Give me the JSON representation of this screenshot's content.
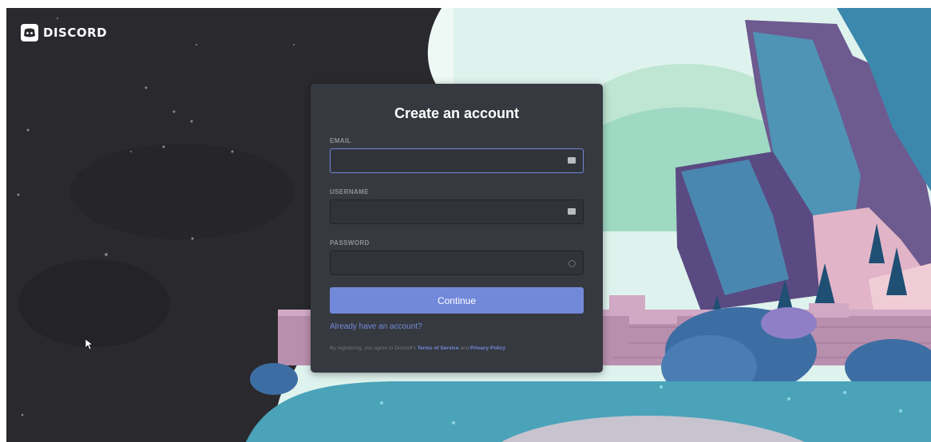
{
  "brand": {
    "logo_icon": "discord-logo-icon",
    "name": "DISCORD"
  },
  "form": {
    "title": "Create an account",
    "email_label": "EMAIL",
    "email_value": "",
    "username_label": "USERNAME",
    "username_value": "",
    "password_label": "PASSWORD",
    "password_value": "",
    "continue_label": "Continue",
    "login_link": "Already have an account?",
    "terms_prefix": "By registering, you agree to Discord's ",
    "terms_of_service": "Terms of Service",
    "terms_and": " and ",
    "privacy_policy": "Privacy Policy"
  },
  "colors": {
    "accent": "#7289da",
    "modal_bg": "#36393f",
    "input_bg": "#303339",
    "space_bg": "#2a292e"
  }
}
